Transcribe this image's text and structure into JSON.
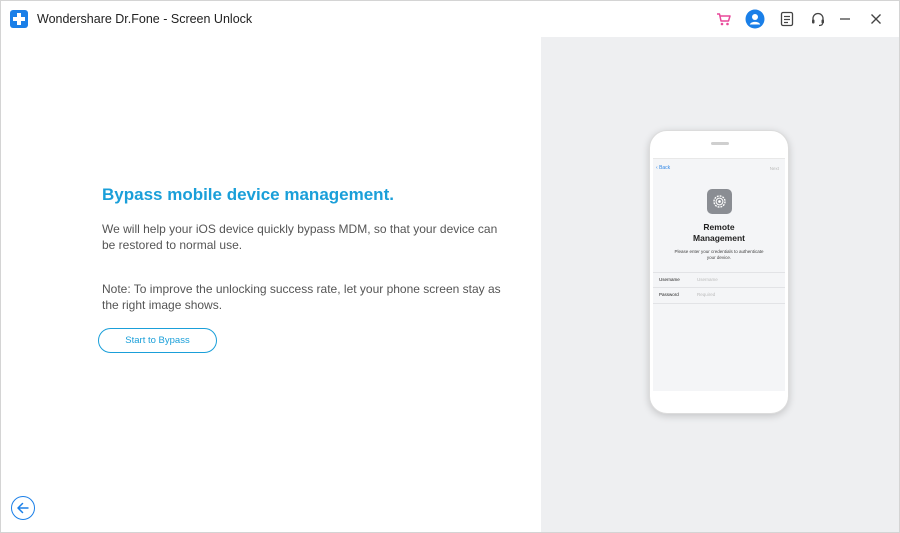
{
  "window": {
    "title": "Wondershare Dr.Fone - Screen Unlock"
  },
  "titlebar": {
    "icons": [
      "cart-icon",
      "account-icon",
      "feedback-icon",
      "support-icon",
      "minimize-icon",
      "close-icon"
    ]
  },
  "main": {
    "heading": "Bypass mobile device management.",
    "description": "We will help your iOS device quickly bypass MDM, so that your device can be restored to normal use.",
    "note": "Note: To improve the unlocking success rate, let your phone screen stay as the right image shows.",
    "start_button_label": "Start to Bypass"
  },
  "phone_screen": {
    "back_label": "Back",
    "next_label": "Next",
    "title_line1": "Remote",
    "title_line2": "Management",
    "subtitle": "Please enter your credentials to authenticate your device.",
    "fields": [
      {
        "label": "Username",
        "placeholder": "Username"
      },
      {
        "label": "Password",
        "placeholder": "Required"
      }
    ]
  },
  "colors": {
    "accent": "#1a9fd9",
    "brand": "#1a7fe8",
    "cart": "#e8489a",
    "right_panel_bg": "#eeeff1"
  }
}
